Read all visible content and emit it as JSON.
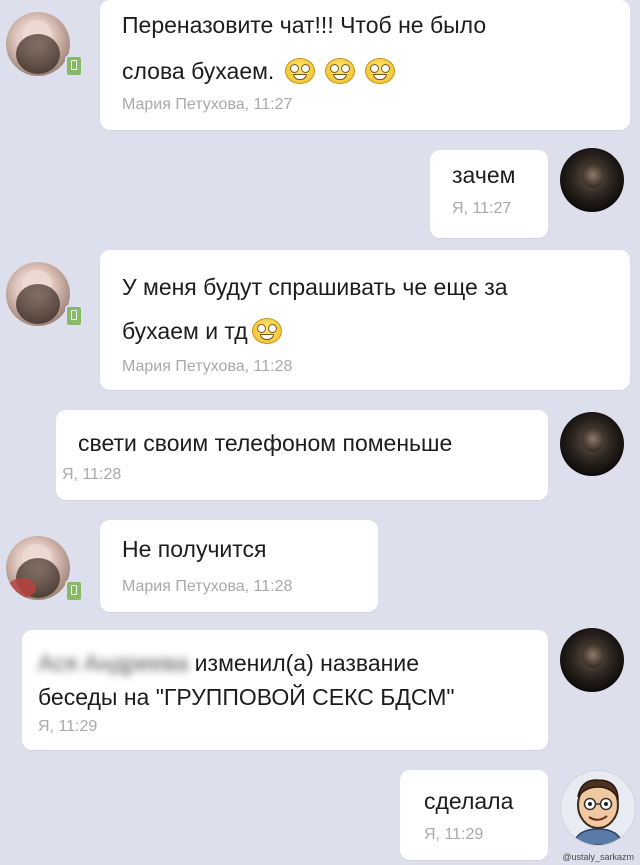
{
  "messages": [
    {
      "side": "in",
      "lines": [
        "Переназовите чат!!! Чтоб не было",
        "слова бухаем."
      ],
      "emoji_count": 3,
      "meta": "Мария Петухова, 11:27"
    },
    {
      "side": "out",
      "lines": [
        "зачем"
      ],
      "meta": "Я, 11:27"
    },
    {
      "side": "in",
      "lines": [
        "У меня будут спрашивать че еще за",
        "бухаем и тд"
      ],
      "emoji_count": 1,
      "meta": "Мария Петухова, 11:28"
    },
    {
      "side": "out",
      "lines": [
        "свети своим телефоном поменьше"
      ],
      "meta": "Я, 11:28"
    },
    {
      "side": "in",
      "lines": [
        "Не получится"
      ],
      "meta": "Мария Петухова, 11:28"
    },
    {
      "side": "out",
      "blurred_name": "Ася Андреева",
      "lines": [
        "изменил(а) название",
        "беседы на \"ГРУППОВОЙ СЕКС БДСМ\""
      ],
      "meta": "Я, 11:29"
    },
    {
      "side": "out",
      "lines": [
        "сделала"
      ],
      "meta": "Я, 11:29"
    }
  ],
  "watermark": "@ustaly_sarkazm",
  "icons": {
    "online_badge": "mobile-online-icon",
    "emoji": "grinning-emoji-icon"
  },
  "colors": {
    "background": "#dde0ec",
    "bubble": "#ffffff",
    "meta_text": "#a7a9ae",
    "online": "#86b968"
  }
}
